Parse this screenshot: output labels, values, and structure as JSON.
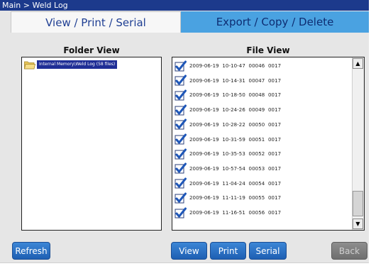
{
  "title_bar": {
    "text": "Main > Weld Log"
  },
  "tabs": [
    {
      "label": "View / Print / Serial",
      "active": true
    },
    {
      "label": "Export / Copy / Delete",
      "active": false
    }
  ],
  "folder_view": {
    "title": "Folder View",
    "items": [
      {
        "label": "Internal Memory\\Weld Log (58 files)",
        "icon": "folder-icon"
      }
    ]
  },
  "file_view": {
    "title": "File View",
    "files": [
      "2009-06-19  10-10-47  00046  0017",
      "2009-06-19  10-14-31  00047  0017",
      "2009-06-19  10-18-50  00048  0017",
      "2009-06-19  10-24-26  00049  0017",
      "2009-06-19  10-28-22  00050  0017",
      "2009-06-19  10-31-59  00051  0017",
      "2009-06-19  10-35-53  00052  0017",
      "2009-06-19  10-57-54  00053  0017",
      "2009-06-19  11-04-24  00054  0017",
      "2009-06-19  11-11-19  00055  0017",
      "2009-06-19  11-16-51  00056  0017"
    ],
    "scroll_up_glyph": "▲",
    "scroll_down_glyph": "▼"
  },
  "buttons": {
    "refresh": "Refresh",
    "view": "View",
    "print": "Print",
    "serial": "Serial",
    "back": "Back"
  },
  "colors": {
    "title_bar": "#1c3a8c",
    "active_tab_text": "#1f3f93",
    "inactive_tab": "#4aa2e1",
    "button": "#2a6fc4",
    "button_disabled": "#7a7a7a"
  }
}
